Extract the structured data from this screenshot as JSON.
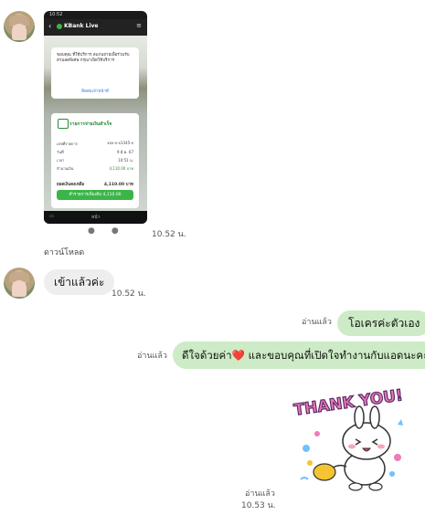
{
  "messages": {
    "m1": {
      "type": "image",
      "time": "10.52 น.",
      "caption": "ดาวน์โหลด",
      "phone": {
        "status_time": "10:52",
        "app_title": "KBank Live",
        "popup_text": "ขอบคุณ ที่ใช้บริการ สแกนจ่ายเพื่อร่วมรับส่วนลดพิเศษ กรุณาเปิดใช้บริการ",
        "popup_button": "ติดต่อเจ้าหน้าที่",
        "card_title": "รายการจ่ายเงินสำเร็จ",
        "rows": [
          {
            "label": "เลขที่รายการ",
            "value": "xxx-x-x1345-x"
          },
          {
            "label": "วันที่",
            "value": "9 มี.ค. 67"
          },
          {
            "label": "เวลา",
            "value": "10:51 น."
          },
          {
            "label": "จำนวนเงิน",
            "value": "4,110.00 บาท"
          }
        ],
        "total_label": "ยอดเงินคงเหลือ",
        "total_value": "4,110.00 บาท",
        "card_button": "ทำรายการเพิ่มเติม 4,110.00",
        "nav_label": "หน้า"
      }
    },
    "m2": {
      "text": "เข้าแล้วค่ะ",
      "time": "10.52 น."
    },
    "m3": {
      "text": "โอเครค่ะตัวเอง",
      "read": "อ่านแล้ว"
    },
    "m4": {
      "text_before": "ดีใจด้วยค่า",
      "heart": "❤️",
      "text_after": " และขอบคุณที่เปิดใจทำงานกับแอดนะคะ",
      "read": "อ่านแล้ว"
    },
    "m5": {
      "type": "sticker",
      "sticker_text": "THANK YOU!",
      "read": "อ่านแล้ว",
      "time": "10.53 น."
    }
  },
  "colors": {
    "incoming_bubble": "#eeeeee",
    "outgoing_bubble": "#cdebc6",
    "accent_green": "#3bb54a"
  }
}
